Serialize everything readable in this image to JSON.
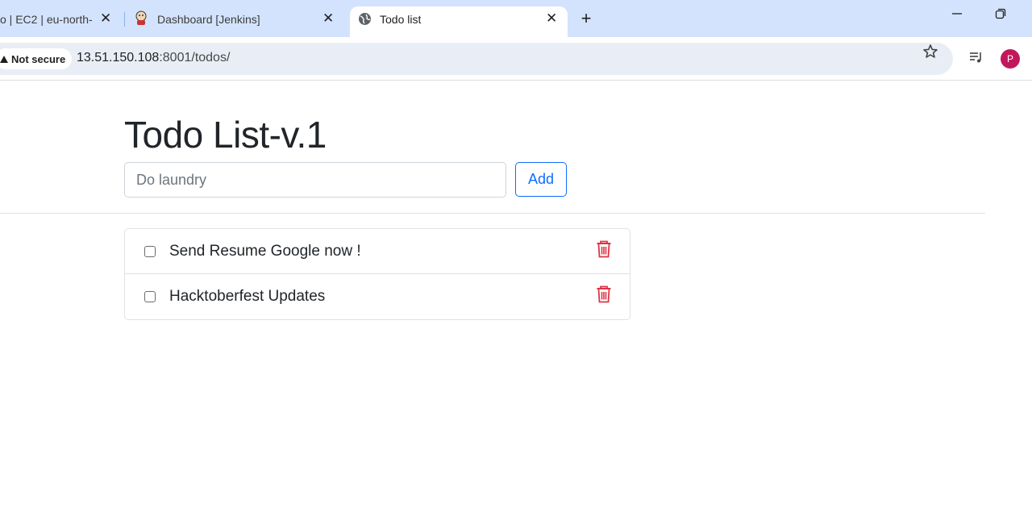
{
  "browser": {
    "tabs": [
      {
        "title": "o | EC2 | eu-north-",
        "active": false,
        "icon": "aws-icon"
      },
      {
        "title": "Dashboard [Jenkins]",
        "active": false,
        "icon": "jenkins-icon"
      },
      {
        "title": "Todo list",
        "active": true,
        "icon": "globe-icon"
      }
    ],
    "new_tab": "+",
    "close_glyph": "✕",
    "security_label": "Not secure",
    "url_host": "13.51.150.108",
    "url_rest": ":8001/todos/",
    "avatar_letter": "P",
    "colors": {
      "tabstrip": "#d3e3fd",
      "omnibox": "#e9eef6",
      "avatar": "#c2185b"
    }
  },
  "page": {
    "title": "Todo List-v.1",
    "input": {
      "placeholder": "Do laundry",
      "value": ""
    },
    "add_label": "Add",
    "todos": [
      {
        "text": "Send Resume Google now !",
        "done": false
      },
      {
        "text": "Hacktoberfest Updates",
        "done": false
      }
    ],
    "colors": {
      "primary": "#0d6efd",
      "delete": "#dc3545",
      "text": "#212529"
    }
  }
}
